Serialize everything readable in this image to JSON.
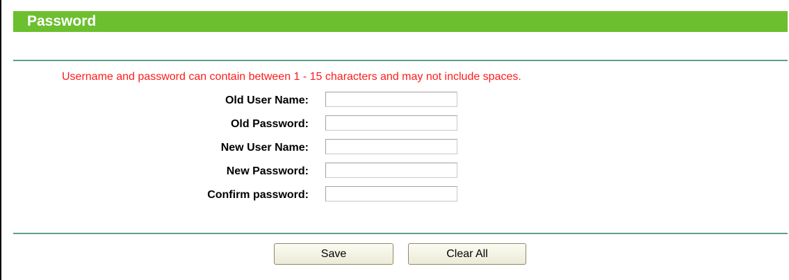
{
  "section": {
    "title": "Password"
  },
  "notice": "Username and password can contain between 1 - 15 characters and may not include spaces.",
  "form": {
    "fields": [
      {
        "label": "Old User Name:",
        "value": ""
      },
      {
        "label": "Old Password:",
        "value": ""
      },
      {
        "label": "New User Name:",
        "value": ""
      },
      {
        "label": "New Password:",
        "value": ""
      },
      {
        "label": "Confirm password:",
        "value": ""
      }
    ]
  },
  "buttons": {
    "save_label": "Save",
    "clear_label": "Clear All"
  },
  "colors": {
    "title_bar": "#6cbf2e",
    "divider": "#5d9e86",
    "notice_text": "#ff1a1a"
  }
}
